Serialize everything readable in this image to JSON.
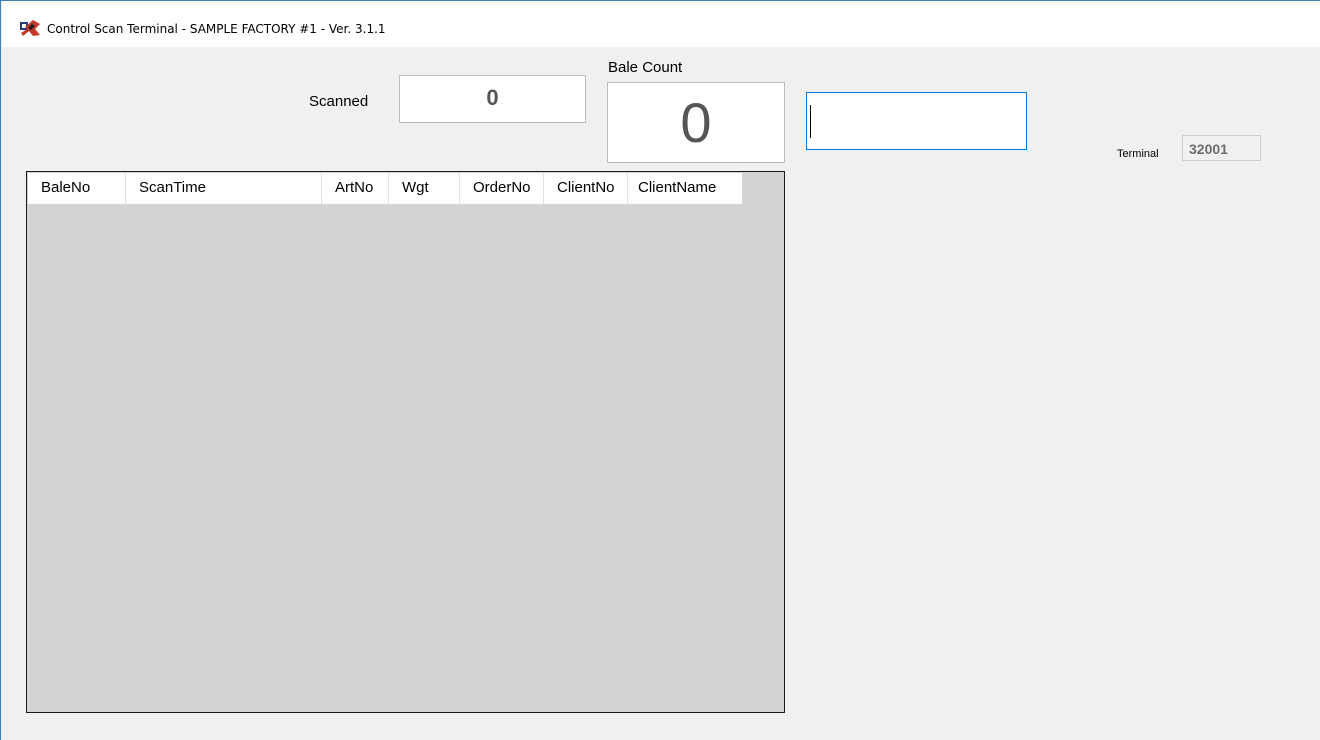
{
  "window": {
    "title": "Control Scan Terminal - SAMPLE FACTORY #1 - Ver. 3.1.1",
    "icon": "scanner-app-icon"
  },
  "scanned": {
    "label": "Scanned",
    "value": "0"
  },
  "bale_count": {
    "label": "Bale Count",
    "value": "0"
  },
  "scan_input": {
    "value": ""
  },
  "terminal": {
    "label": "Terminal",
    "value": "32001"
  },
  "grid": {
    "columns": [
      {
        "label": "BaleNo"
      },
      {
        "label": "ScanTime"
      },
      {
        "label": "ArtNo"
      },
      {
        "label": "Wgt"
      },
      {
        "label": "OrderNo"
      },
      {
        "label": "ClientNo"
      },
      {
        "label": "ClientName"
      }
    ],
    "rows": []
  },
  "colors": {
    "window_bg": "#f0f0f0",
    "grid_bg": "#d3d3d3",
    "input_focus_border": "#0078d7",
    "value_text": "#555555"
  }
}
